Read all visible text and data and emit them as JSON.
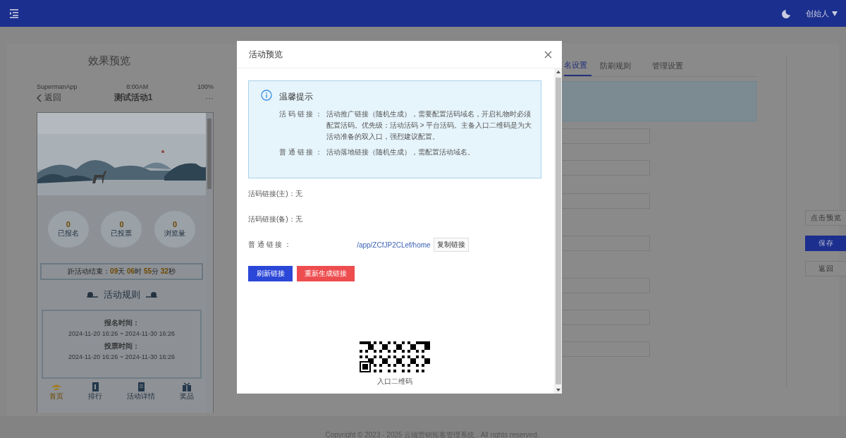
{
  "header": {
    "user": "创始人"
  },
  "preview": {
    "title": "效果预览",
    "status_bar": {
      "carrier": "SupermanApp",
      "time": "8:00AM",
      "battery": "100%"
    },
    "nav": {
      "back": "返回",
      "title": "测试活动1",
      "more": "···"
    },
    "stats": [
      {
        "value": "0",
        "label": "已报名"
      },
      {
        "value": "0",
        "label": "已投票"
      },
      {
        "value": "0",
        "label": "浏览量"
      }
    ],
    "countdown": {
      "label": "距活动结束：",
      "parts": [
        {
          "value": "09",
          "unit": "天"
        },
        {
          "value": "06",
          "unit": "时"
        },
        {
          "value": "55",
          "unit": "分"
        },
        {
          "value": "32",
          "unit": "秒"
        }
      ]
    },
    "rules_title": "活动规则",
    "rules": [
      {
        "heading": "报名时间：",
        "value": "2024-11-20 16:26 ~ 2024-11-30 16:26"
      },
      {
        "heading": "投票时间：",
        "value": "2024-11-20 16:26 ~ 2024-11-30 16:26"
      }
    ],
    "tabbar": [
      {
        "label": "首页",
        "kind": "home",
        "selected": true
      },
      {
        "label": "排行",
        "kind": "rank",
        "selected": false
      },
      {
        "label": "活动详情",
        "kind": "detail",
        "selected": false
      },
      {
        "label": "奖品",
        "kind": "prize",
        "selected": false
      }
    ]
  },
  "settings": {
    "tabs": [
      {
        "label": "名设置",
        "selected": true
      },
      {
        "label": "防刷规则",
        "selected": false
      },
      {
        "label": "管理设置",
        "selected": false
      }
    ],
    "fields": [
      {
        "kind": "input"
      },
      {
        "kind": "input"
      },
      {
        "kind": "input"
      },
      {
        "kind": "input"
      },
      {
        "kind": "input"
      },
      {
        "kind": "input"
      },
      {
        "kind": "input"
      }
    ]
  },
  "actions": [
    {
      "label": "点击预览",
      "kind": "default"
    },
    {
      "label": "保存",
      "kind": "primary"
    },
    {
      "label": "返回",
      "kind": "default"
    }
  ],
  "modal": {
    "title": "活动预览",
    "notice": {
      "title": "温馨提示",
      "items": [
        {
          "label": "活 码 链 接 ：",
          "text": "活动推广链接（随机生成），需要配置活码域名，开启礼物时必须配置活码。优先级：活动活码 > 平台活码。主备入口二维码是为大活动准备的双入口，强烈建议配置。"
        },
        {
          "label": "普 通 链 接 ：",
          "text": "活动落地链接（随机生成），需配置活动域名。"
        }
      ]
    },
    "links": [
      {
        "kind": "text",
        "text": "活码链接(主)：无"
      },
      {
        "kind": "text",
        "text": "活码链接(备)：无"
      },
      {
        "kind": "url",
        "label": "普 通 链 接 ：",
        "url": "/app/ZCfJP2CLef/home",
        "copy": "复制链接"
      }
    ],
    "buttons": [
      {
        "label": "刷新链接",
        "kind": "primary"
      },
      {
        "label": "重新生成链接",
        "kind": "danger"
      }
    ],
    "qr_caption": "入口二维码"
  },
  "footer": "Copyright © 2023 - 2025 云端营销拓客管理系统 . All rights reserved."
}
